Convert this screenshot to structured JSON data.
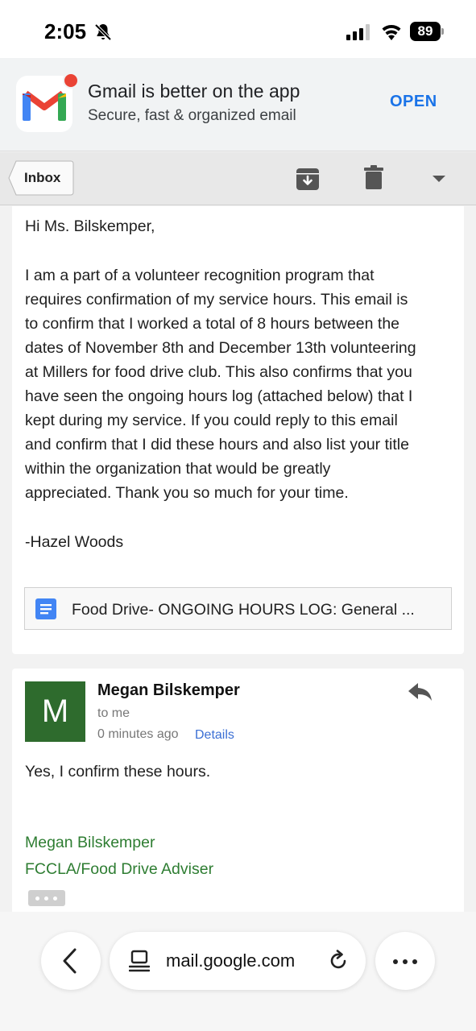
{
  "status_bar": {
    "time": "2:05",
    "battery": "89",
    "icons": [
      "bell-slash-icon",
      "cellular-signal-icon",
      "wifi-icon",
      "battery-icon"
    ]
  },
  "promo": {
    "title": "Gmail is better on the app",
    "subtitle": "Secure, fast & organized email",
    "open_label": "OPEN",
    "open_color": "#1a73e8"
  },
  "toolbar": {
    "inbox_label": "Inbox",
    "icons": [
      "archive-icon",
      "trash-icon",
      "chevron-down-icon"
    ]
  },
  "message": {
    "lines": [
      "Hi Ms. Bilskemper,",
      "",
      "I am a part of a volunteer recognition program that",
      "requires confirmation of my service hours. This email is",
      "to confirm that I worked a total of 8 hours between the",
      "dates of November 8th and December 13th volunteering",
      "at Millers for food drive club. This also confirms that you",
      "have seen the ongoing hours log (attached below) that I",
      "kept during my service. If you could reply to this email",
      "and confirm that I did these hours and also list your title",
      "within the organization that would be greatly",
      "appreciated. Thank you so much for your time.",
      "",
      "-Hazel Woods"
    ],
    "attachment_name": "Food Drive- ONGOING HOURS LOG: General ..."
  },
  "reply": {
    "avatar_letter": "M",
    "avatar_color": "#2e6b2d",
    "sender": "Megan Bilskemper",
    "to": "to me",
    "time": "0 minutes ago",
    "details_label": "Details",
    "body": "Yes, I confirm these hours.",
    "signature_name": "Megan Bilskemper",
    "signature_title": "FCCLA/Food Drive Adviser",
    "signature_color": "#2e7d32"
  },
  "browser": {
    "url": "mail.google.com",
    "icons": [
      "back-icon",
      "page-icon",
      "reload-icon",
      "more-icon"
    ]
  }
}
